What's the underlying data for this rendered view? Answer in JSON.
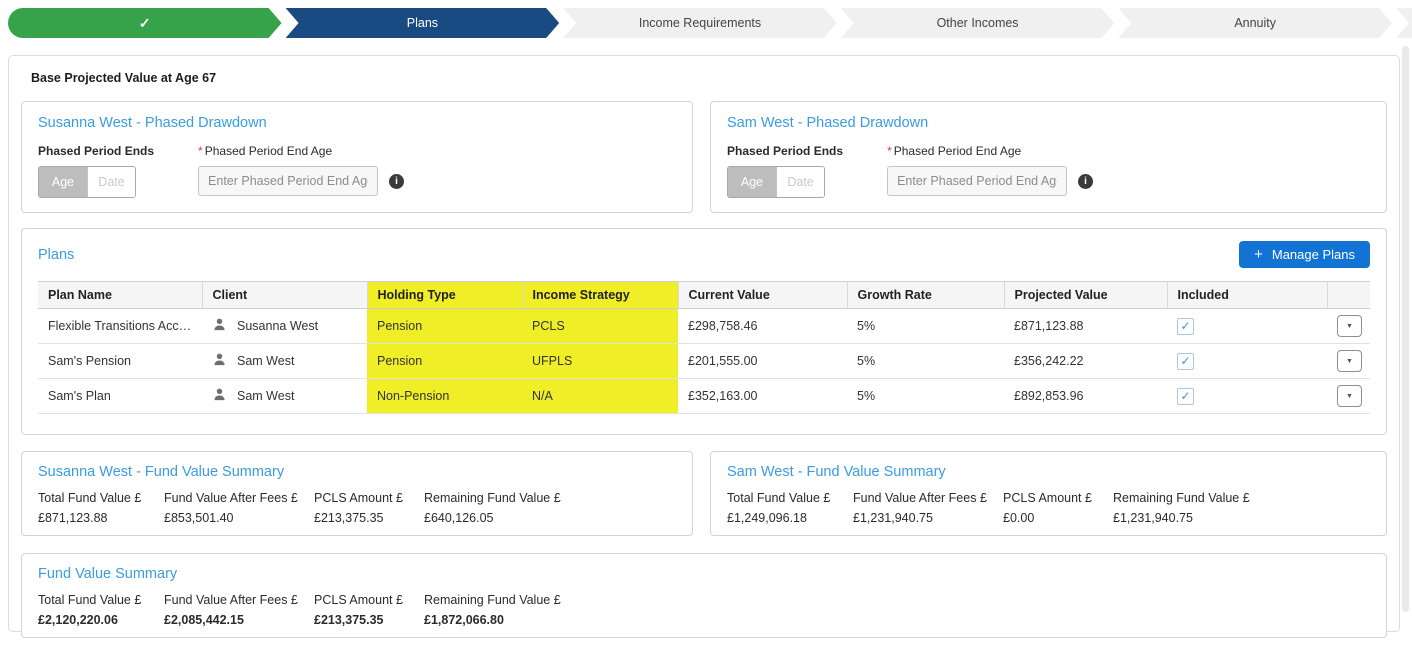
{
  "wizard": {
    "steps": [
      {
        "label": "",
        "state": "complete"
      },
      {
        "label": "Plans",
        "state": "active"
      },
      {
        "label": "Income Requirements",
        "state": "default"
      },
      {
        "label": "Other Incomes",
        "state": "default"
      },
      {
        "label": "Annuity",
        "state": "default"
      }
    ]
  },
  "icons": {
    "check": "✓",
    "plus": "+",
    "caret_down": "▼",
    "info": "i"
  },
  "colors": {
    "step_complete_green": "#36a24a",
    "step_active_blue": "#1a4a82",
    "heading_blue": "#3a9ce1",
    "highlight_yellow": "#f0ee27",
    "primary_button_blue": "#1273d4"
  },
  "page_title": "Base Projected Value at Age 67",
  "phased_panels": [
    {
      "title": "Susanna West - Phased Drawdown",
      "toggle_label": "Phased Period Ends",
      "age_label": "Age",
      "date_label": "Date",
      "required_marker": "*",
      "field_label": "Phased Period End Age",
      "placeholder": "Enter Phased Period End Age"
    },
    {
      "title": "Sam West - Phased Drawdown",
      "toggle_label": "Phased Period Ends",
      "age_label": "Age",
      "date_label": "Date",
      "required_marker": "*",
      "field_label": "Phased Period End Age",
      "placeholder": "Enter Phased Period End Age"
    }
  ],
  "plans": {
    "title": "Plans",
    "manage_button": "Manage Plans",
    "columns": [
      "Plan Name",
      "Client",
      "Holding Type",
      "Income Strategy",
      "Current Value",
      "Growth Rate",
      "Projected Value",
      "Included"
    ],
    "rows": [
      {
        "plan_name": "Flexible Transitions Accou...",
        "client": "Susanna West",
        "holding_type": "Pension",
        "income_strategy": "PCLS",
        "current_value": "£298,758.46",
        "growth_rate": "5%",
        "projected_value": "£871,123.88",
        "included": true
      },
      {
        "plan_name": "Sam's Pension",
        "client": "Sam West",
        "holding_type": "Pension",
        "income_strategy": "UFPLS",
        "current_value": "£201,555.00",
        "growth_rate": "5%",
        "projected_value": "£356,242.22",
        "included": true
      },
      {
        "plan_name": "Sam's Plan",
        "client": "Sam West",
        "holding_type": "Non-Pension",
        "income_strategy": "N/A",
        "current_value": "£352,163.00",
        "growth_rate": "5%",
        "projected_value": "£892,853.96",
        "included": true
      }
    ]
  },
  "summaries": [
    {
      "title": "Susanna West - Fund Value Summary",
      "items": [
        {
          "label": "Total Fund Value £",
          "value": "£871,123.88"
        },
        {
          "label": "Fund Value After Fees £",
          "value": "£853,501.40"
        },
        {
          "label": "PCLS Amount £",
          "value": "£213,375.35"
        },
        {
          "label": "Remaining Fund Value £",
          "value": "£640,126.05"
        }
      ]
    },
    {
      "title": "Sam West - Fund Value Summary",
      "items": [
        {
          "label": "Total Fund Value £",
          "value": "£1,249,096.18"
        },
        {
          "label": "Fund Value After Fees £",
          "value": "£1,231,940.75"
        },
        {
          "label": "PCLS Amount £",
          "value": "£0.00"
        },
        {
          "label": "Remaining Fund Value £",
          "value": "£1,231,940.75"
        }
      ]
    },
    {
      "title": "Fund Value Summary",
      "items": [
        {
          "label": "Total Fund Value £",
          "value": "£2,120,220.06"
        },
        {
          "label": "Fund Value After Fees £",
          "value": "£2,085,442.15"
        },
        {
          "label": "PCLS Amount £",
          "value": "£213,375.35"
        },
        {
          "label": "Remaining Fund Value £",
          "value": "£1,872,066.80"
        }
      ]
    }
  ]
}
